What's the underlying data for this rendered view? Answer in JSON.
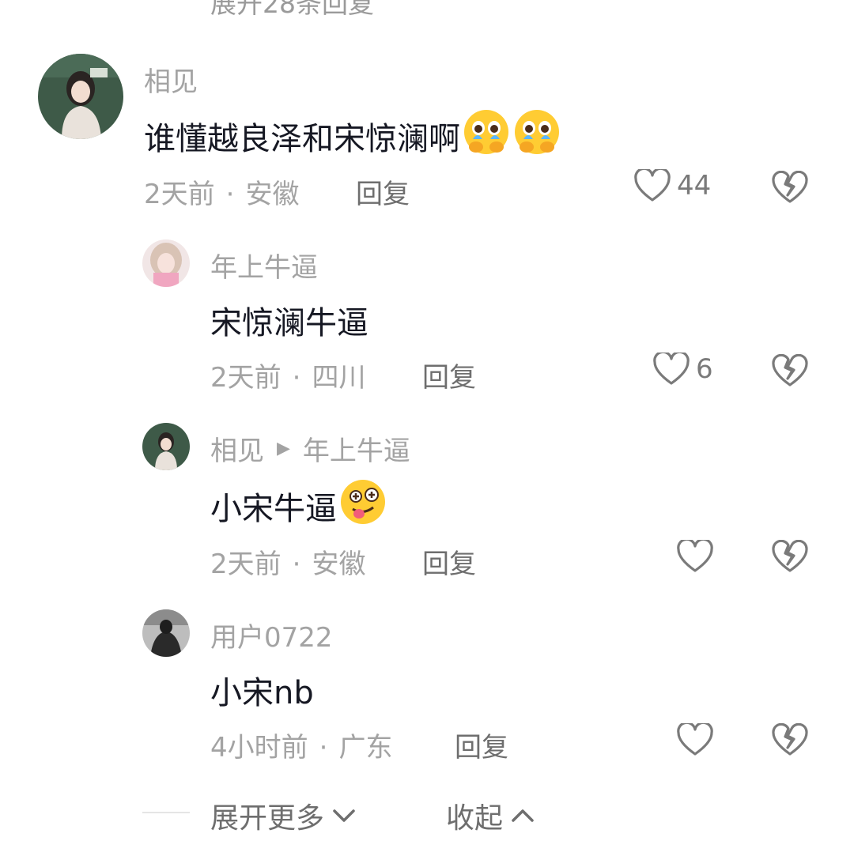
{
  "top_partial_text": "展开28条回复",
  "comments": [
    {
      "name": "相见",
      "text": "谁懂越良泽和宋惊澜啊",
      "emoji": [
        "pleading-face-emoji",
        "pleading-face-emoji"
      ],
      "time": "2天前",
      "location": "安徽",
      "reply_label": "回复",
      "likes": "44"
    },
    {
      "name": "年上牛逼",
      "text": "宋惊澜牛逼",
      "time": "2天前",
      "location": "四川",
      "reply_label": "回复",
      "likes": "6"
    },
    {
      "name": "相见",
      "reply_to": "年上牛逼",
      "text": "小宋牛逼",
      "emoji": [
        "woozy-face-emoji"
      ],
      "time": "2天前",
      "location": "安徽",
      "reply_label": "回复",
      "likes": ""
    },
    {
      "name": "用户0722",
      "text": "小宋nb",
      "time": "4小时前",
      "location": "广东",
      "reply_label": "回复",
      "likes": ""
    }
  ],
  "footer": {
    "expand_more": "展开更多",
    "collapse": "收起"
  },
  "icons": {
    "like": "heart-outline-icon",
    "dislike": "broken-heart-icon",
    "expand": "chevron-down-icon",
    "collapse": "chevron-up-icon",
    "reply_arrow": "triangle-right-icon"
  },
  "colors": {
    "name_gray": "#a3a3a3",
    "text_dark": "#161823",
    "icon_gray": "#7a7a7a"
  }
}
